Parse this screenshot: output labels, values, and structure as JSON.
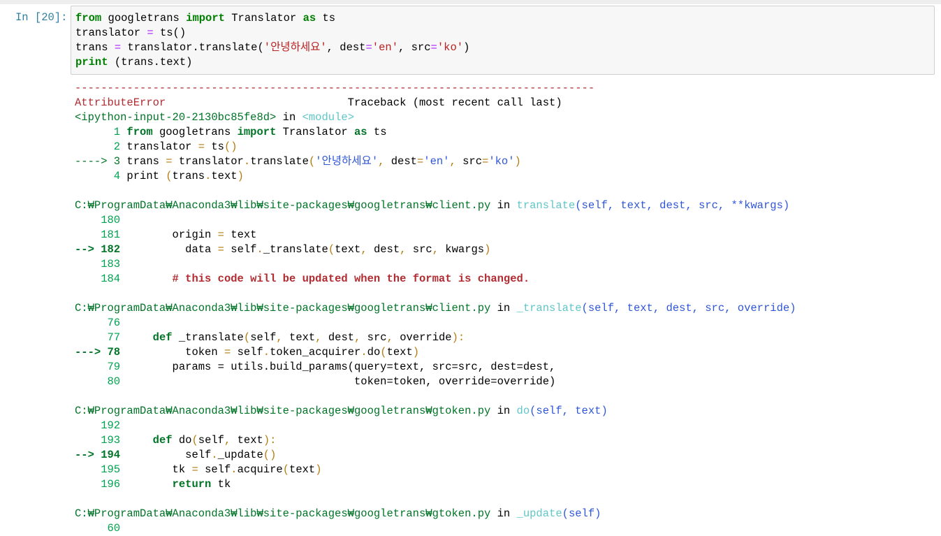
{
  "cell": {
    "prompt": "In [20]:",
    "input_lines": [
      [
        [
          "from",
          "kw"
        ],
        [
          " googletrans ",
          "n"
        ],
        [
          "import",
          "kw"
        ],
        [
          " Translator ",
          "n"
        ],
        [
          "as",
          "kw"
        ],
        [
          " ts",
          "n"
        ]
      ],
      [
        [
          "translator ",
          "n"
        ],
        [
          "=",
          "op"
        ],
        [
          " ts()",
          "n"
        ]
      ],
      [
        [
          "trans ",
          "n"
        ],
        [
          "=",
          "op"
        ],
        [
          " translator.translate(",
          "n"
        ],
        [
          "'안녕하세요'",
          "str"
        ],
        [
          ", dest",
          "n"
        ],
        [
          "=",
          "op"
        ],
        [
          "'en'",
          "str"
        ],
        [
          ", src",
          "n"
        ],
        [
          "=",
          "op"
        ],
        [
          "'ko'",
          "str"
        ],
        [
          ")",
          "n"
        ]
      ],
      [
        [
          "print",
          "kw"
        ],
        [
          " (trans.text)",
          "n"
        ]
      ]
    ]
  },
  "traceback": {
    "lines": [
      [
        [
          "--------------------------------------------------------------------------------",
          "r"
        ]
      ],
      [
        [
          "AttributeError",
          "r"
        ],
        [
          "                            Traceback (most recent call last)",
          "n"
        ]
      ],
      [
        [
          "<ipython-input-20-2130bc85fe8d>",
          "G"
        ],
        [
          " in ",
          "n"
        ],
        [
          "<module>",
          "c"
        ]
      ],
      [
        [
          "      1 ",
          "g"
        ],
        [
          "from",
          "gk"
        ],
        [
          " googletrans ",
          "n"
        ],
        [
          "import",
          "gk"
        ],
        [
          " Translator ",
          "n"
        ],
        [
          "as",
          "gk"
        ],
        [
          " ts",
          "n"
        ]
      ],
      [
        [
          "      2 ",
          "g"
        ],
        [
          "translator ",
          "n"
        ],
        [
          "=",
          "y"
        ],
        [
          " ts",
          "n"
        ],
        [
          "()",
          "y"
        ]
      ],
      [
        [
          "----> 3 ",
          "G"
        ],
        [
          "trans ",
          "n"
        ],
        [
          "=",
          "y"
        ],
        [
          " translator",
          "n"
        ],
        [
          ".",
          "y"
        ],
        [
          "translate",
          "n"
        ],
        [
          "(",
          "y"
        ],
        [
          "'안녕하세요'",
          "b"
        ],
        [
          ", ",
          "y"
        ],
        [
          "dest",
          "n"
        ],
        [
          "=",
          "y"
        ],
        [
          "'en'",
          "b"
        ],
        [
          ", ",
          "y"
        ],
        [
          "src",
          "n"
        ],
        [
          "=",
          "y"
        ],
        [
          "'ko'",
          "b"
        ],
        [
          ")",
          "y"
        ]
      ],
      [
        [
          "      4 ",
          "g"
        ],
        [
          "print ",
          "n"
        ],
        [
          "(",
          "y"
        ],
        [
          "trans",
          "n"
        ],
        [
          ".",
          "y"
        ],
        [
          "text",
          "n"
        ],
        [
          ")",
          "y"
        ]
      ],
      [],
      [
        [
          "C:₩ProgramData₩Anaconda3₩lib₩site-packages₩googletrans₩client.py",
          "G"
        ],
        [
          " in ",
          "n"
        ],
        [
          "translate",
          "c"
        ],
        [
          "(self, text, dest, src, **kwargs)",
          "b"
        ]
      ],
      [
        [
          "    180",
          "g"
        ]
      ],
      [
        [
          "    181",
          "g"
        ],
        [
          "        origin ",
          "n"
        ],
        [
          "=",
          "y"
        ],
        [
          " text",
          "n"
        ]
      ],
      [
        [
          "--> 182",
          "Gb"
        ],
        [
          "          data ",
          "n"
        ],
        [
          "=",
          "y"
        ],
        [
          " self",
          "n"
        ],
        [
          ".",
          "y"
        ],
        [
          "_translate",
          "n"
        ],
        [
          "(",
          "y"
        ],
        [
          "text",
          ""
        ],
        [
          ", ",
          "y"
        ],
        [
          "dest",
          "n"
        ],
        [
          ", ",
          "y"
        ],
        [
          "src",
          "n"
        ],
        [
          ", ",
          "y"
        ],
        [
          "kwargs",
          "n"
        ],
        [
          ")",
          "y"
        ]
      ],
      [
        [
          "    183",
          "g"
        ]
      ],
      [
        [
          "    184",
          "g"
        ],
        [
          "        ",
          "n"
        ],
        [
          "# this code will be updated when the format is changed.",
          "rb"
        ]
      ],
      [],
      [
        [
          "C:₩ProgramData₩Anaconda3₩lib₩site-packages₩googletrans₩client.py",
          "G"
        ],
        [
          " in ",
          "n"
        ],
        [
          "_translate",
          "c"
        ],
        [
          "(self, text, dest, src, override)",
          "b"
        ]
      ],
      [
        [
          "     76",
          "g"
        ]
      ],
      [
        [
          "     77",
          "g"
        ],
        [
          "     ",
          "n"
        ],
        [
          "def",
          "gk"
        ],
        [
          " _translate",
          "n"
        ],
        [
          "(",
          "y"
        ],
        [
          "self",
          "n"
        ],
        [
          ", ",
          "y"
        ],
        [
          "text",
          "n"
        ],
        [
          ", ",
          "y"
        ],
        [
          "dest",
          "n"
        ],
        [
          ", ",
          "y"
        ],
        [
          "src",
          "n"
        ],
        [
          ", ",
          "y"
        ],
        [
          "override",
          "n"
        ],
        [
          "):",
          "y"
        ]
      ],
      [
        [
          "---> 78",
          "Gb"
        ],
        [
          "          token ",
          "n"
        ],
        [
          "=",
          "y"
        ],
        [
          " self",
          "n"
        ],
        [
          ".",
          "y"
        ],
        [
          "token_acquirer",
          "n"
        ],
        [
          ".",
          "y"
        ],
        [
          "do",
          "n"
        ],
        [
          "(",
          "y"
        ],
        [
          "text",
          "n"
        ],
        [
          ")",
          "y"
        ]
      ],
      [
        [
          "     79",
          "g"
        ],
        [
          "        params = utils.build_params(query=text, src=src, dest=dest,",
          "n"
        ]
      ],
      [
        [
          "     80",
          "g"
        ],
        [
          "                                    token=token, override=override)",
          "n"
        ]
      ],
      [],
      [
        [
          "C:₩ProgramData₩Anaconda3₩lib₩site-packages₩googletrans₩gtoken.py",
          "G"
        ],
        [
          " in ",
          "n"
        ],
        [
          "do",
          "c"
        ],
        [
          "(self, text)",
          "b"
        ]
      ],
      [
        [
          "    192",
          "g"
        ]
      ],
      [
        [
          "    193",
          "g"
        ],
        [
          "     ",
          "n"
        ],
        [
          "def",
          "gk"
        ],
        [
          " do",
          "n"
        ],
        [
          "(",
          "y"
        ],
        [
          "self",
          "n"
        ],
        [
          ", ",
          "y"
        ],
        [
          "text",
          "n"
        ],
        [
          "):",
          "y"
        ]
      ],
      [
        [
          "--> 194",
          "Gb"
        ],
        [
          "          self",
          "n"
        ],
        [
          ".",
          "y"
        ],
        [
          "_update",
          "n"
        ],
        [
          "()",
          "y"
        ]
      ],
      [
        [
          "    195",
          "g"
        ],
        [
          "        tk ",
          "n"
        ],
        [
          "=",
          "y"
        ],
        [
          " self",
          "n"
        ],
        [
          ".",
          "y"
        ],
        [
          "acquire",
          "n"
        ],
        [
          "(",
          "y"
        ],
        [
          "text",
          "n"
        ],
        [
          ")",
          "y"
        ]
      ],
      [
        [
          "    196",
          "g"
        ],
        [
          "        ",
          "n"
        ],
        [
          "return",
          "gk"
        ],
        [
          " tk",
          "n"
        ]
      ],
      [],
      [
        [
          "C:₩ProgramData₩Anaconda3₩lib₩site-packages₩googletrans₩gtoken.py",
          "G"
        ],
        [
          " in ",
          "n"
        ],
        [
          "_update",
          "c"
        ],
        [
          "(self)",
          "b"
        ]
      ],
      [
        [
          "     60",
          "g"
        ]
      ]
    ]
  }
}
